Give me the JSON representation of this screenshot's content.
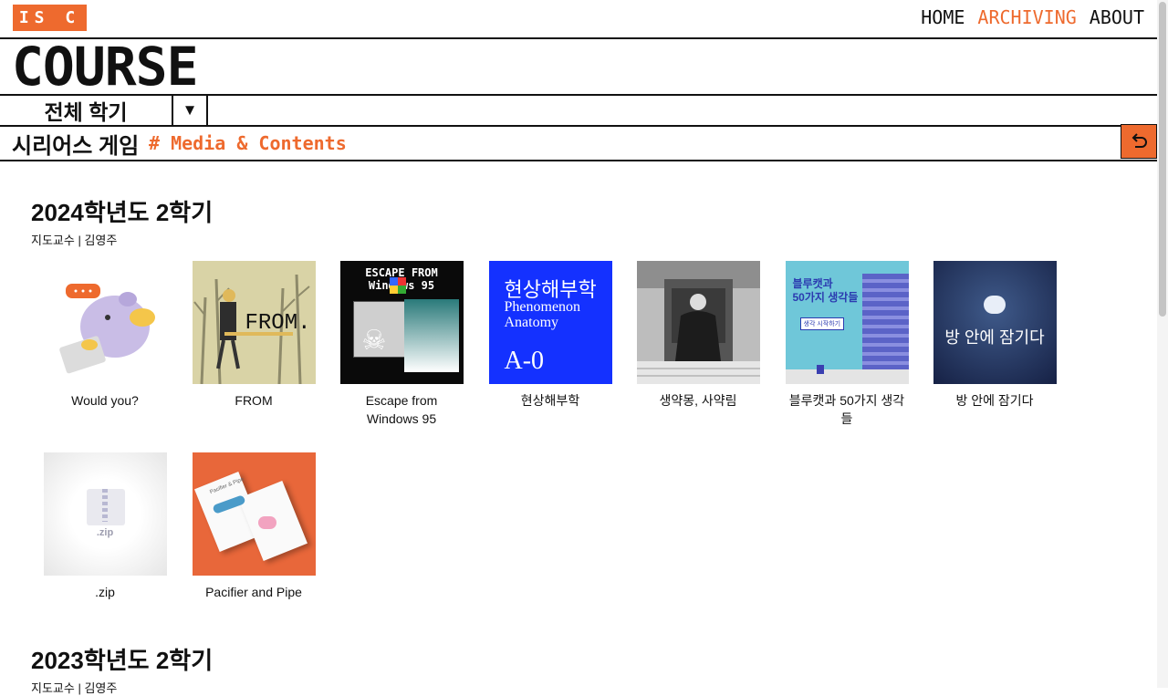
{
  "header": {
    "logo_text": "IS C",
    "nav": [
      {
        "label": "HOME",
        "active": false
      },
      {
        "label": "ARCHIVING",
        "active": true
      },
      {
        "label": "ABOUT",
        "active": false
      }
    ],
    "accent_color": "#ee6a2e"
  },
  "page_title": "COURSE",
  "semester_filter": {
    "selected": "전체 학기",
    "dropdown_icon": "triangle-down-icon"
  },
  "subject": {
    "name": "시리어스 게임",
    "tag": "# Media & Contents",
    "back_icon": "undo-icon"
  },
  "sections": [
    {
      "title": "2024학년도 2학기",
      "professor": "지도교수 | 김영주",
      "items": [
        {
          "label": "Would you?"
        },
        {
          "label": "FROM",
          "art_text": "FROM."
        },
        {
          "label": "Escape from Windows 95",
          "art_text": "ESCAPE FROM Windows 95"
        },
        {
          "label": "현상해부학",
          "art_title": "현상해부학",
          "art_sub1": "Phenomenon",
          "art_sub2": "Anatomy",
          "art_code": "A-0"
        },
        {
          "label": "생약몽, 사약림"
        },
        {
          "label": "블루캣과 50가지 생각들",
          "art_text1": "블루캣과",
          "art_text2": "50가지 생각들",
          "art_button": "생각 시작하기"
        },
        {
          "label": "방 안에 잠기다",
          "art_text": "방 안에 잠기다"
        },
        {
          "label": ".zip",
          "art_text": ".zip"
        },
        {
          "label": "Pacifier and Pipe",
          "art_text": "Pacifier & Pipe"
        }
      ]
    },
    {
      "title": "2023학년도 2학기",
      "professor": "지도교수 | 김영주"
    }
  ]
}
